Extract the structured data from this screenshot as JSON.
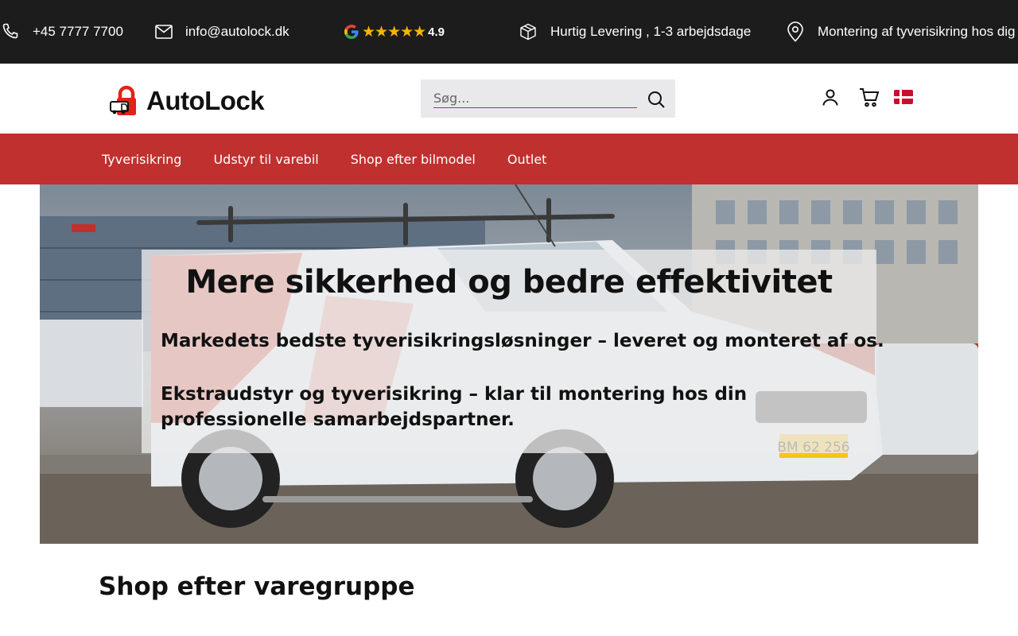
{
  "topbar": {
    "phone": "+45 7777 7700",
    "email": "info@autolock.dk",
    "rating": {
      "stars": "★★★★★",
      "score": "4.9"
    },
    "delivery": "Hurtig Levering , 1-3 arbejdsdage",
    "mounting": "Montering af tyverisikring hos dig"
  },
  "header": {
    "logo_text": "AutoLock",
    "search": {
      "placeholder": "Søg..."
    }
  },
  "nav": {
    "items": [
      {
        "label": "Tyverisikring"
      },
      {
        "label": "Udstyr til varebil"
      },
      {
        "label": "Shop efter bilmodel"
      },
      {
        "label": "Outlet"
      }
    ]
  },
  "hero": {
    "title": "Mere sikkerhed og bedre effektivitet",
    "subtitle_1": "Markedets bedste tyverisikringsløsninger – leveret og monteret af os.",
    "subtitle_2": "Ekstraudstyr og tyverisikring – klar til montering hos din professionelle samarbejdspartner.",
    "plate": "BM 62 256"
  },
  "section": {
    "title": "Shop efter varegruppe"
  },
  "colors": {
    "topbar_bg": "#1c1c1c",
    "accent_red": "#c0302e",
    "star": "#f7b500"
  },
  "icons": [
    "phone-icon",
    "mail-icon",
    "google-icon",
    "star-icon",
    "package-icon",
    "map-pin-icon",
    "search-icon",
    "user-icon",
    "cart-icon",
    "flag-denmark-icon"
  ]
}
